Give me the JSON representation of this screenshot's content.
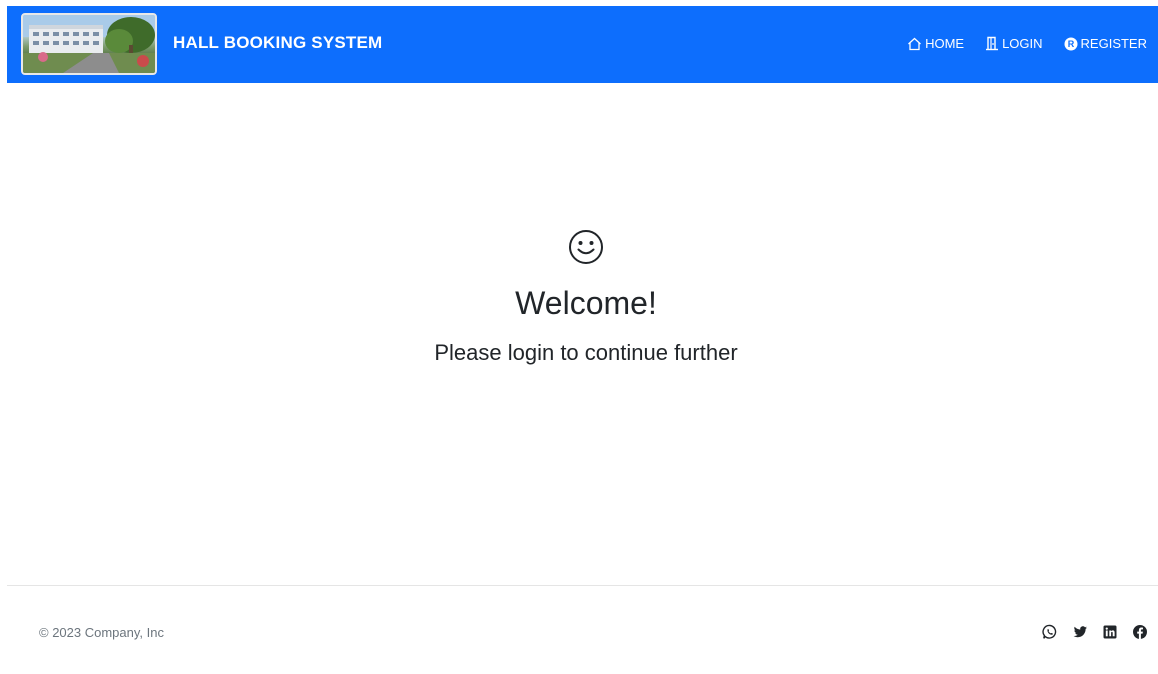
{
  "header": {
    "brand": "HALL BOOKING SYSTEM",
    "logo_icon": "campus-building-photo",
    "nav": [
      {
        "label": "HOME",
        "icon": "house-icon"
      },
      {
        "label": "LOGIN",
        "icon": "door-icon"
      },
      {
        "label": "REGISTER",
        "icon": "registered-icon"
      }
    ],
    "background_color": "#0d6efd"
  },
  "main": {
    "icon": "smiley-icon",
    "title": "Welcome!",
    "subtitle": "Please login to continue further"
  },
  "footer": {
    "copyright": "© 2023 Company, Inc",
    "social": [
      "whatsapp-icon",
      "twitter-icon",
      "linkedin-icon",
      "facebook-icon"
    ]
  }
}
